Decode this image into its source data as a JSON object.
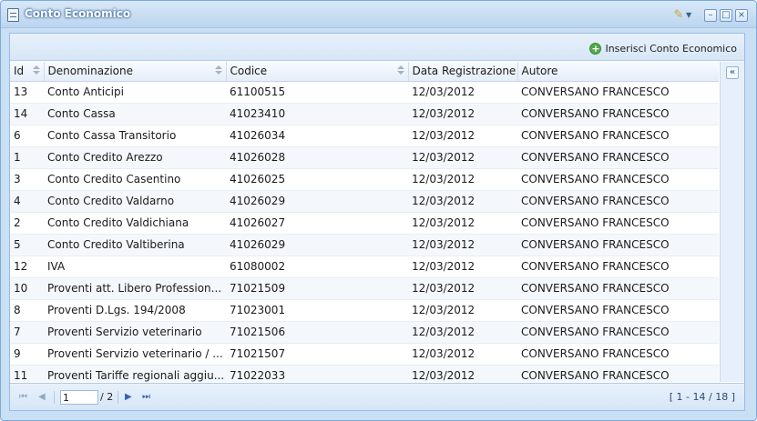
{
  "window": {
    "title": "Conto Economico",
    "controls": {
      "minimize": "–",
      "maximize": "□",
      "close": "×"
    }
  },
  "toolbar": {
    "add_label": "Inserisci Conto Economico"
  },
  "grid": {
    "columns": [
      "Id",
      "Denominazione",
      "Codice",
      "Data Registrazione",
      "Autore"
    ],
    "rows": [
      [
        "13",
        "Conto Anticipi",
        "61100515",
        "12/03/2012",
        "CONVERSANO FRANCESCO"
      ],
      [
        "14",
        "Conto Cassa",
        "41023410",
        "12/03/2012",
        "CONVERSANO FRANCESCO"
      ],
      [
        "6",
        "Conto Cassa Transitorio",
        "41026034",
        "12/03/2012",
        "CONVERSANO FRANCESCO"
      ],
      [
        "1",
        "Conto Credito Arezzo",
        "41026028",
        "12/03/2012",
        "CONVERSANO FRANCESCO"
      ],
      [
        "3",
        "Conto Credito Casentino",
        "41026025",
        "12/03/2012",
        "CONVERSANO FRANCESCO"
      ],
      [
        "4",
        "Conto Credito Valdarno",
        "41026029",
        "12/03/2012",
        "CONVERSANO FRANCESCO"
      ],
      [
        "2",
        "Conto Credito Valdichiana",
        "41026027",
        "12/03/2012",
        "CONVERSANO FRANCESCO"
      ],
      [
        "5",
        "Conto Credito Valtiberina",
        "41026029",
        "12/03/2012",
        "CONVERSANO FRANCESCO"
      ],
      [
        "12",
        "IVA",
        "61080002",
        "12/03/2012",
        "CONVERSANO FRANCESCO"
      ],
      [
        "10",
        "Proventi att. Libero Profession...",
        "71021509",
        "12/03/2012",
        "CONVERSANO FRANCESCO"
      ],
      [
        "8",
        "Proventi D.Lgs. 194/2008",
        "71023001",
        "12/03/2012",
        "CONVERSANO FRANCESCO"
      ],
      [
        "7",
        "Proventi Servizio veterinario",
        "71021506",
        "12/03/2012",
        "CONVERSANO FRANCESCO"
      ],
      [
        "9",
        "Proventi Servizio veterinario / ...",
        "71021507",
        "12/03/2012",
        "CONVERSANO FRANCESCO"
      ],
      [
        "11",
        "Proventi Tariffe regionali aggiu...",
        "71022033",
        "12/03/2012",
        "CONVERSANO FRANCESCO"
      ]
    ]
  },
  "side": {
    "collapse_label": "«"
  },
  "pager": {
    "current_page": "1",
    "of_label": "/ 2",
    "first": "⏮",
    "prev": "◀",
    "next": "▶",
    "last": "⏭",
    "info": "[ 1 - 14 / 18 ]"
  },
  "colors": {
    "accent": "#99bbe8",
    "title_gradient_top": "#d8e8f8",
    "add_icon": "#54a84b"
  },
  "icons": {
    "window": "document-icon",
    "tools": "wrench-icon",
    "add": "plus-circle-icon"
  }
}
